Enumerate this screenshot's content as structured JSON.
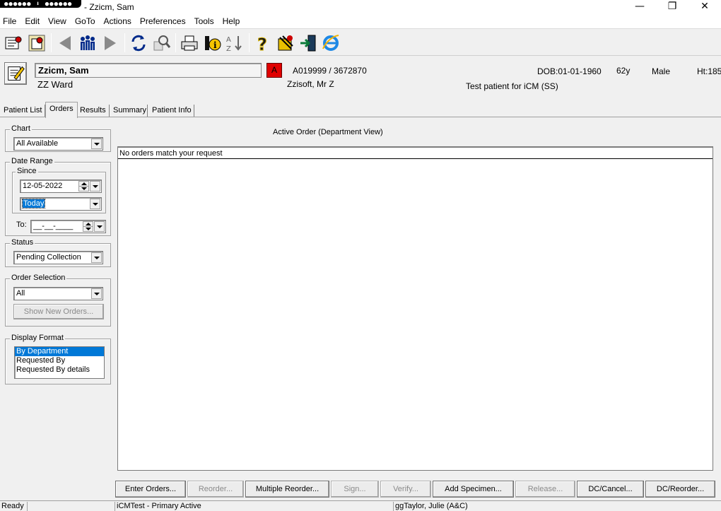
{
  "window": {
    "title": "- Zzicm, Sam",
    "badge_text": "●●●●●● ⬇ ●●●●●●",
    "minimize": "—",
    "restore": "❐",
    "close": "✕"
  },
  "menu": [
    "File",
    "Edit",
    "View",
    "GoTo",
    "Actions",
    "Preferences",
    "Tools",
    "Help"
  ],
  "toolbar": {
    "icons": [
      "patient-list-icon",
      "patient-select-icon",
      "back-arrow-icon",
      "people-icon",
      "forward-arrow-icon",
      "refresh-icon",
      "search-icon",
      "print-icon",
      "info-icon",
      "sort-icon",
      "help-icon",
      "settings-icon",
      "exit-icon",
      "internet-explorer-icon"
    ]
  },
  "patient": {
    "name": "Zzicm, Sam",
    "ward": "ZZ Ward",
    "allergy_flag": "A",
    "ids": "A019999 / 3672870",
    "doctor": "Zzisoft, Mr Z",
    "dob": "DOB:01-01-1960",
    "age": "62y",
    "sex": "Male",
    "height": "Ht:185",
    "note": "Test patient for iCM (SS)"
  },
  "tabs": [
    {
      "label": "Patient List",
      "active": false
    },
    {
      "label": "Orders",
      "active": true
    },
    {
      "label": "Results",
      "active": false
    },
    {
      "label": "Summary",
      "active": false
    },
    {
      "label": "Patient Info",
      "active": false
    }
  ],
  "filters": {
    "chart": {
      "label": "Chart",
      "value": "All Available"
    },
    "date_range": {
      "label": "Date Range",
      "since_label": "Since",
      "since_date": "12-05-2022",
      "since_preset": "Today",
      "to_label": "To:",
      "to_value": "__-__-____"
    },
    "status": {
      "label": "Status",
      "value": "Pending Collection"
    },
    "order_selection": {
      "label": "Order Selection",
      "value": "All",
      "show_new_button": "Show New Orders..."
    },
    "display_format": {
      "label": "Display Format",
      "options": [
        "By Department",
        "Requested By",
        "Requested By details"
      ],
      "selected": "By Department"
    }
  },
  "main": {
    "title": "Active Order (Department View)",
    "empty_message": "No orders match your request"
  },
  "buttons": [
    {
      "label": "Enter Orders...",
      "enabled": true
    },
    {
      "label": "Reorder...",
      "enabled": false
    },
    {
      "label": "Multiple Reorder...",
      "enabled": true
    },
    {
      "label": "Sign...",
      "enabled": false
    },
    {
      "label": "Verify...",
      "enabled": false
    },
    {
      "label": "Add Specimen...",
      "enabled": true
    },
    {
      "label": "Release...",
      "enabled": false
    },
    {
      "label": "DC/Cancel...",
      "enabled": true
    },
    {
      "label": "DC/Reorder...",
      "enabled": true
    }
  ],
  "statusbar": {
    "state": "Ready",
    "environment": "iCMTest - Primary Active",
    "user": "ggTaylor, Julie  (A&C)"
  }
}
